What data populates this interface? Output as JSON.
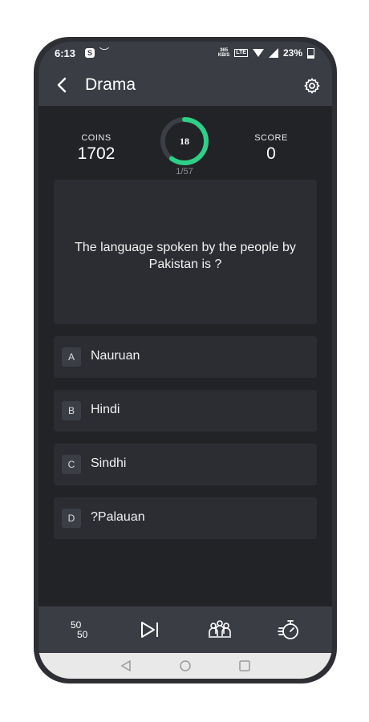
{
  "status_bar": {
    "time": "6:13",
    "app_icon_letter": "S",
    "network_speed": "365\nKB/S",
    "network_type": "LTE",
    "battery": "23%"
  },
  "appbar": {
    "title": "Drama"
  },
  "stats": {
    "coins_label": "COINS",
    "coins_value": "1702",
    "timer_value": "18",
    "timer_fraction_remaining": 0.6,
    "progress": "1/57",
    "score_label": "SCORE",
    "score_value": "0"
  },
  "question": {
    "text": "The language spoken by the people by Pakistan is ?"
  },
  "options": [
    {
      "letter": "A",
      "text": "Nauruan"
    },
    {
      "letter": "B",
      "text": "Hindi"
    },
    {
      "letter": "C",
      "text": "Sindhi"
    },
    {
      "letter": "D",
      "text": "?Palauan"
    }
  ],
  "lifelines": {
    "fifty_fifty": "50 50"
  },
  "colors": {
    "accent": "#2ecf86",
    "background": "#222327",
    "card": "#2b2d33",
    "bar": "#3a3d44"
  }
}
